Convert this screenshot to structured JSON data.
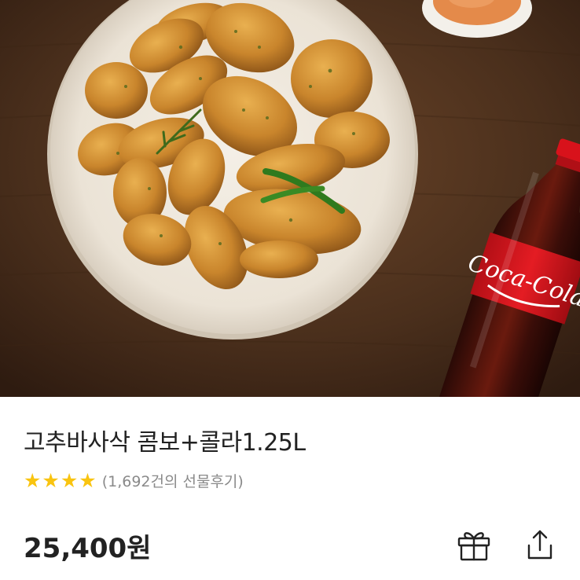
{
  "product": {
    "title": "고추바사삭 콤보+콜라1.25L",
    "rating_stars": 4,
    "review_count_text": "(1,692건의 선물후기)",
    "price": "25,400원"
  },
  "hero_image": {
    "brand_text": "Coca-Cola"
  },
  "icons": {
    "star": "star-icon",
    "gift": "gift-icon",
    "share": "share-icon"
  },
  "colors": {
    "star": "#f9c410",
    "title": "#222222",
    "subtext": "#8a8a8a",
    "background_wood": "#4a2f1c"
  }
}
